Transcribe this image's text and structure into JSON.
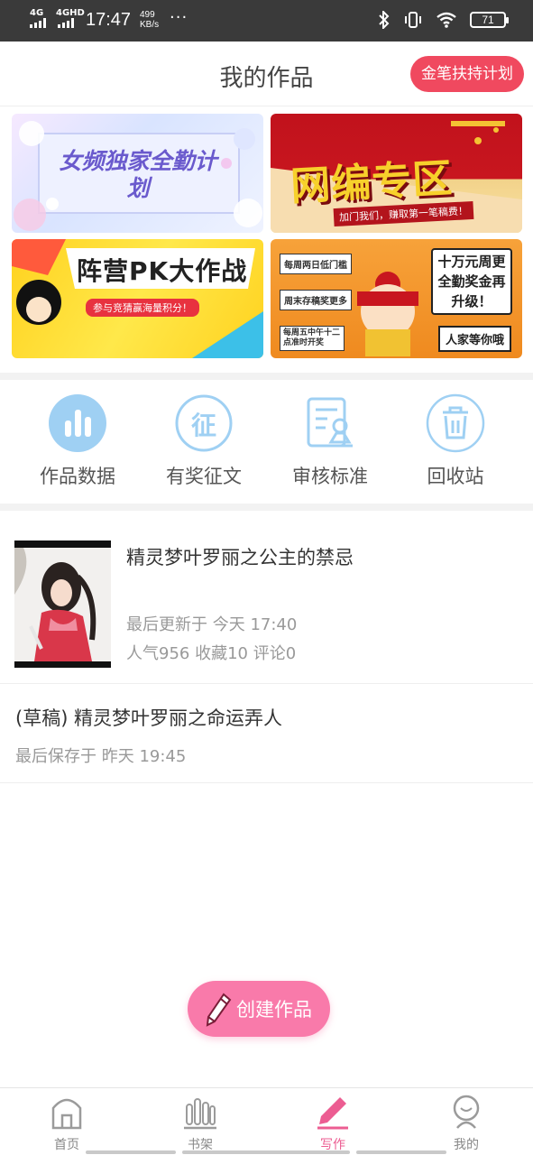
{
  "status_bar": {
    "net1": "4G",
    "net2": "4GHD",
    "time": "17:47",
    "speed_value": "499",
    "speed_unit": "KB/s",
    "more": "···",
    "battery": "71"
  },
  "header": {
    "title": "我的作品",
    "support_button": "金笔扶持计划"
  },
  "banners": [
    {
      "text": "女频独家全勤计划"
    },
    {
      "text": "网编专区",
      "subtext": "加门我们，赚取第一笔稿费！"
    },
    {
      "text": "阵营PK大作战",
      "subtext": "参与竞猜赢海量积分！"
    },
    {
      "text": "十万元周更全勤奖金再升级！",
      "tag1": "每周两日低门槛",
      "tag2": "周末存稿奖更多",
      "tag3": "每周五中午十二点准时开奖",
      "tag4": "人家等你哦"
    }
  ],
  "tools": [
    {
      "label": "作品数据",
      "icon": "bar-chart-icon"
    },
    {
      "label": "有奖征文",
      "icon": "contest-icon",
      "glyph": "征"
    },
    {
      "label": "审核标准",
      "icon": "review-standard-icon"
    },
    {
      "label": "回收站",
      "icon": "trash-icon"
    }
  ],
  "works": [
    {
      "title": "精灵梦叶罗丽之公主的禁忌",
      "updated": "最后更新于 今天 17:40",
      "stats": "人气956 收藏10 评论0"
    },
    {
      "title": "(草稿) 精灵梦叶罗丽之命运弄人",
      "saved": "最后保存于 昨天 19:45"
    }
  ],
  "create_button": "创建作品",
  "tabs": [
    {
      "label": "首页",
      "icon": "home-icon"
    },
    {
      "label": "书架",
      "icon": "bookshelf-icon"
    },
    {
      "label": "写作",
      "icon": "pen-icon",
      "active": true
    },
    {
      "label": "我的",
      "icon": "profile-icon"
    }
  ],
  "colors": {
    "accent_red": "#f0495f",
    "accent_pink": "#f97aaa",
    "icon_blue": "#9fd0f3",
    "active_tab": "#ec5d92"
  }
}
